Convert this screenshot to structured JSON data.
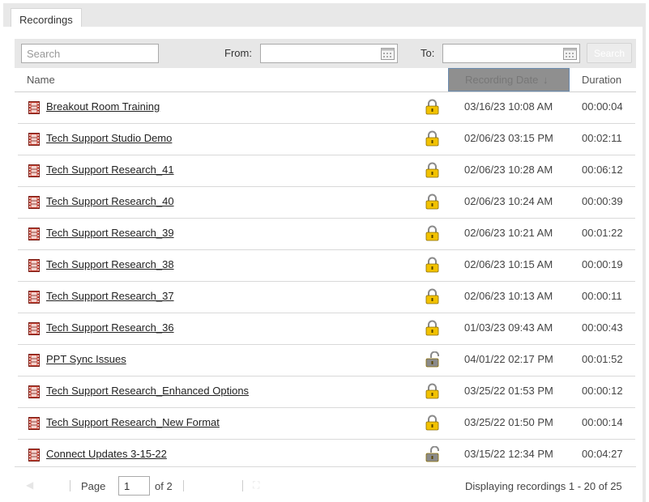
{
  "tab": {
    "label": "Recordings"
  },
  "toolbar": {
    "search_placeholder": "Search",
    "from_label": "From:",
    "to_label": "To:",
    "search_button": "Search"
  },
  "columns": {
    "name": "Name",
    "recording_date": "Recording Date",
    "sort_indicator": "↓",
    "duration": "Duration"
  },
  "rows": [
    {
      "name": "Breakout Room Training",
      "date": "03/16/23 10:08 AM",
      "duration": "00:00:04",
      "lock": "locked"
    },
    {
      "name": "Tech Support Studio Demo",
      "date": "02/06/23 03:15 PM",
      "duration": "00:02:11",
      "lock": "locked"
    },
    {
      "name": "Tech Support Research_41",
      "date": "02/06/23 10:28 AM",
      "duration": "00:06:12",
      "lock": "locked"
    },
    {
      "name": "Tech Support Research_40",
      "date": "02/06/23 10:24 AM",
      "duration": "00:00:39",
      "lock": "locked"
    },
    {
      "name": "Tech Support Research_39",
      "date": "02/06/23 10:21 AM",
      "duration": "00:01:22",
      "lock": "locked"
    },
    {
      "name": "Tech Support Research_38",
      "date": "02/06/23 10:15 AM",
      "duration": "00:00:19",
      "lock": "locked"
    },
    {
      "name": "Tech Support Research_37",
      "date": "02/06/23 10:13 AM",
      "duration": "00:00:11",
      "lock": "locked"
    },
    {
      "name": "Tech Support Research_36",
      "date": "01/03/23 09:43 AM",
      "duration": "00:00:43",
      "lock": "locked"
    },
    {
      "name": "PPT Sync Issues",
      "date": "04/01/22 02:17 PM",
      "duration": "00:01:52",
      "lock": "unlocked"
    },
    {
      "name": "Tech Support Research_Enhanced Options",
      "date": "03/25/22 01:53 PM",
      "duration": "00:00:12",
      "lock": "locked"
    },
    {
      "name": "Tech Support Research_New Format",
      "date": "03/25/22 01:50 PM",
      "duration": "00:00:14",
      "lock": "locked"
    },
    {
      "name": "Connect Updates 3-15-22",
      "date": "03/15/22 12:34 PM",
      "duration": "00:04:27",
      "lock": "unlocked"
    }
  ],
  "pagination": {
    "page_label": "Page",
    "current_page": "1",
    "of_label": "of 2",
    "status": "Displaying recordings 1 - 20 of 25"
  },
  "icons": {
    "recording": "film-icon",
    "locked": "lock-closed-icon",
    "unlocked": "lock-open-icon",
    "calendar": "calendar-icon"
  },
  "colors": {
    "locked_icon": "#f2c200",
    "unlocked_icon": "#8a8a8a",
    "film_icon": "#c0392b",
    "sorted_header_bg": "#8f8f8f"
  }
}
